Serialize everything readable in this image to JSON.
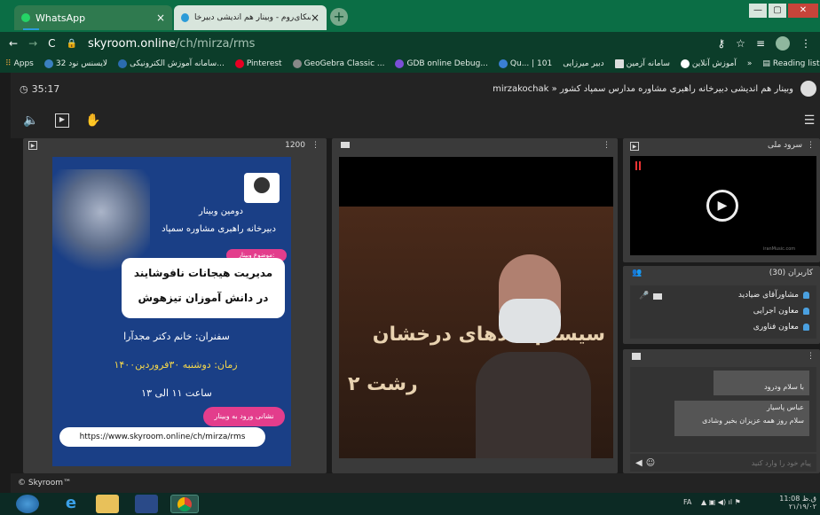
{
  "browser": {
    "tabs": [
      {
        "label": "WhatsApp",
        "close": "×"
      },
      {
        "label": "اسکای‌روم - وبینار هم اندیشی دبیرخا...",
        "close": "×"
      }
    ],
    "new_tab": "+",
    "window_controls": [
      "—",
      "▢",
      "✕"
    ],
    "address": {
      "domain": "skyroom.online",
      "path": "/ch/mirza/rms"
    },
    "bookmarks": [
      "Apps",
      "لایسنس نود 32",
      "سامانه آموزش الکترونیکی...",
      "Pinterest",
      "GeoGebra Classic ...",
      "GDB online Debug...",
      "Qu... | 101",
      "دبیر میرزایی",
      "سامانه آزمین",
      "آموزش آنلاین",
      "»",
      "Reading list"
    ]
  },
  "app": {
    "timer": "35:17",
    "room_title": "mirzakochak » وبینار هم اندیشی دبیرخانه راهبری مشاوره مدارس سمپاد کشور",
    "slide_panel": {
      "count": "1200"
    },
    "right_panels": {
      "anthem_title": "سرود ملی",
      "video_source": "iranMusic.com",
      "users_title": "کاربران (30)",
      "users": [
        {
          "name": "مشاورآقای ضیادید"
        },
        {
          "name": "معاون اجرایی"
        },
        {
          "name": "معاون فناوری"
        }
      ],
      "chat_messages": [
        {
          "sender": "",
          "text": "با سلام ودرود"
        },
        {
          "sender": "عباس پاسیار",
          "text": "سلام روز همه عزیزان بخیر وشادی"
        }
      ],
      "chat_placeholder": "پیام خود را وارد کنید"
    },
    "footer": "© Skyroom™"
  },
  "slide": {
    "line1": "دومین وبینار",
    "line2": "دبیرخانه راهبری مشاوره سمپاد",
    "topic_tag": "موضوع وبینار:",
    "topic1": "مدیریت هیجانات نافوشایند",
    "topic2": "در دانش آموزان تیزهوش",
    "speaker": "سفنران: خانم دکتر مجدآرا",
    "date": "زمان: دوشنبه ۳۰فروردین۱۴۰۰",
    "time": "ساعت ۱۱ الی ۱۳",
    "link_label": "نشانی ورود به وبینار",
    "link": "https://www.skyroom.online/ch/mirza/rms"
  },
  "video_bg": {
    "line1": "سیستم هادهای درخشان",
    "line2": "رشت ۲"
  },
  "taskbar": {
    "lang": "FA",
    "time": "11:08 ق.ظ",
    "date": "۲۱/۱۹/۰۲"
  },
  "colors": {
    "browser_green": "#0b6e45",
    "app_bg": "#232323",
    "panel": "#3a3a3a",
    "accent": "#2b9bd8",
    "slide_bg": "#1a3f86"
  }
}
